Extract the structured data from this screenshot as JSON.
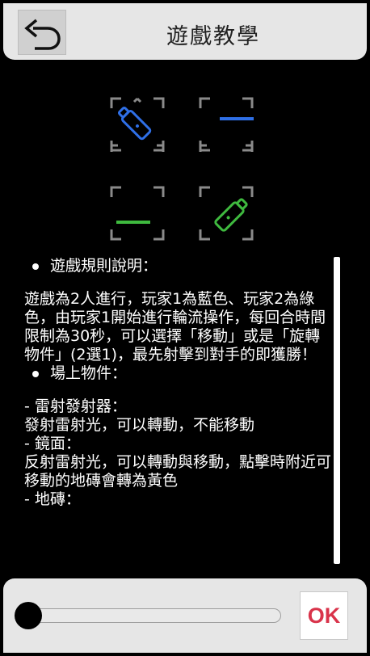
{
  "header": {
    "title": "遊戲教學",
    "back_icon": "undo-arrow-icon"
  },
  "board": {
    "cells": [
      {
        "position": "top-left",
        "content": "blue-laser-emitter-icon",
        "color": "#2f6fe6"
      },
      {
        "position": "top-right",
        "content": "blue-line-marker",
        "color": "#2f6fe6"
      },
      {
        "position": "bottom-left",
        "content": "green-line-marker",
        "color": "#3fba3f"
      },
      {
        "position": "bottom-right",
        "content": "green-laser-emitter-icon",
        "color": "#3fba3f"
      }
    ]
  },
  "rules": {
    "section1_title": "遊戲規則說明：",
    "section1_body": "遊戲為2人進行，玩家1為藍色、玩家2為綠色，由玩家1開始進行輪流操作，每回合時間限制為30秒，可以選擇「移動」或是「旋轉物件」(2選1)，最先射擊到對手的即獲勝！",
    "section2_title": "場上物件：",
    "items": [
      {
        "name": "- 雷射發射器：",
        "desc": "發射雷射光，可以轉動，不能移動"
      },
      {
        "name": "- 鏡面：",
        "desc": "反射雷射光，可以轉動與移動，點擊時附近可移動的地磚會轉為黃色"
      },
      {
        "name": "- 地磚：",
        "desc": ""
      }
    ]
  },
  "footer": {
    "ok_label": "OK",
    "slider_value": 0
  },
  "colors": {
    "player1": "#2f6fe6",
    "player2": "#3fba3f",
    "ok_text": "#d9334a"
  }
}
